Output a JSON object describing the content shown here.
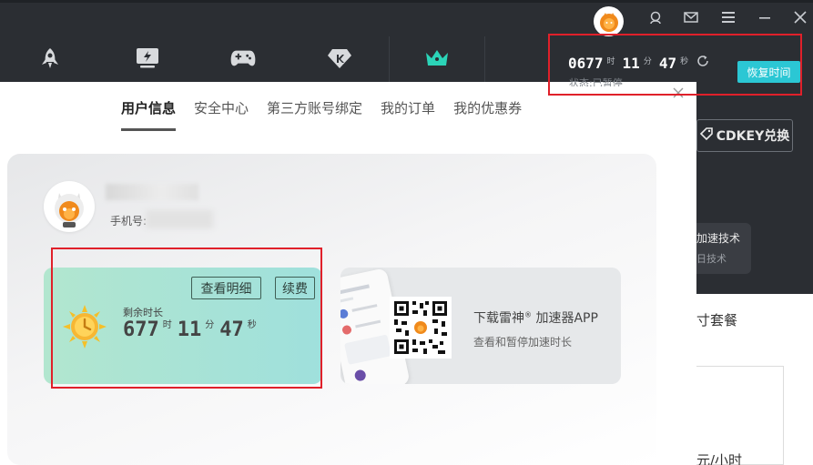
{
  "header": {
    "timer": {
      "hours": "0677",
      "hours_unit": "时",
      "minutes": "11",
      "minutes_unit": "分",
      "seconds": "47",
      "seconds_unit": "秒",
      "status": "状态:已暂停"
    },
    "restore_label": "恢复时间"
  },
  "background_panel": {
    "cdkey_label": "CDKEY兑换",
    "tech_title": "加速技术",
    "tech_sub": "日技术",
    "package_text": "寸套餐",
    "hour_text": "元/小时"
  },
  "modal": {
    "tabs": [
      {
        "label": "用户信息",
        "active": true
      },
      {
        "label": "安全中心",
        "active": false
      },
      {
        "label": "第三方账号绑定",
        "active": false
      },
      {
        "label": "我的订单",
        "active": false
      },
      {
        "label": "我的优惠券",
        "active": false
      }
    ],
    "user": {
      "phone_label": "手机号:"
    },
    "remain_card": {
      "detail_label": "查看明细",
      "renew_label": "续费",
      "title": "剩余时长",
      "hours": "677",
      "hours_unit": "时",
      "minutes": "11",
      "minutes_unit": "分",
      "seconds": "47",
      "seconds_unit": "秒"
    },
    "app_card": {
      "title": "下载雷神",
      "title_sup": "®",
      "title_rest": " 加速器APP",
      "subtitle": "查看和暂停加速时长"
    }
  },
  "colors": {
    "accent": "#2bc7d4",
    "highlight_outline": "#e0202a",
    "dark_bg": "#2b2e33",
    "crown_active": "#2bd4b8"
  }
}
